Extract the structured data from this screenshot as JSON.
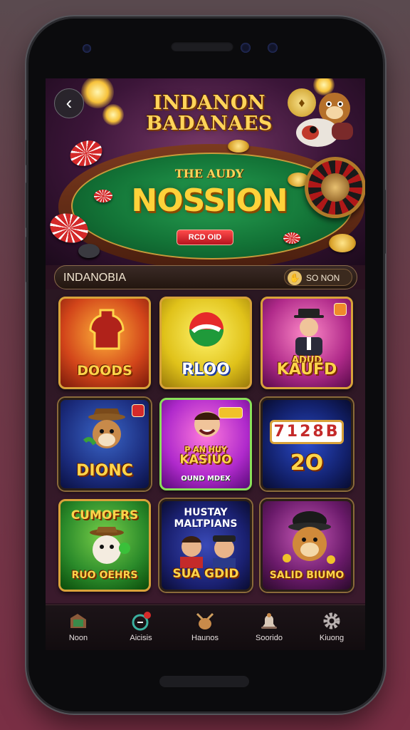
{
  "hero": {
    "title_line1": "INDANON",
    "title_line2": "BADANAES",
    "felt_subtitle": "THE AUDY",
    "felt_title": "NOSSION",
    "play_button": "RCD OID"
  },
  "search": {
    "text": "INDANOBIA",
    "pill_label": "SO NON"
  },
  "games": [
    {
      "label": "DOODS"
    },
    {
      "label": "RLOO"
    },
    {
      "label": "KAUFD",
      "top": "ADUD"
    },
    {
      "label": "DIONC"
    },
    {
      "label": "KASIUO",
      "top": "P AN HUY",
      "bottom": "OUND MDEX"
    },
    {
      "label": "2O",
      "reels": "7128B"
    },
    {
      "label": "RUO OEHRS",
      "top": "CUMOFRS"
    },
    {
      "label": "SUA GDID",
      "top": "HUSTAY MALTPIANS"
    },
    {
      "label": "SALID BIUMO"
    }
  ],
  "nav": {
    "items": [
      {
        "label": "Noon",
        "icon": "home-icon"
      },
      {
        "label": "Aicisis",
        "icon": "activity-icon"
      },
      {
        "label": "Haunos",
        "icon": "games-icon"
      },
      {
        "label": "Soorido",
        "icon": "bell-icon"
      },
      {
        "label": "Kiuong",
        "icon": "gear-icon"
      }
    ]
  },
  "colors": {
    "accent_gold": "#ffd54a",
    "felt_green": "#1f8f48",
    "play_red": "#d42a2a"
  }
}
